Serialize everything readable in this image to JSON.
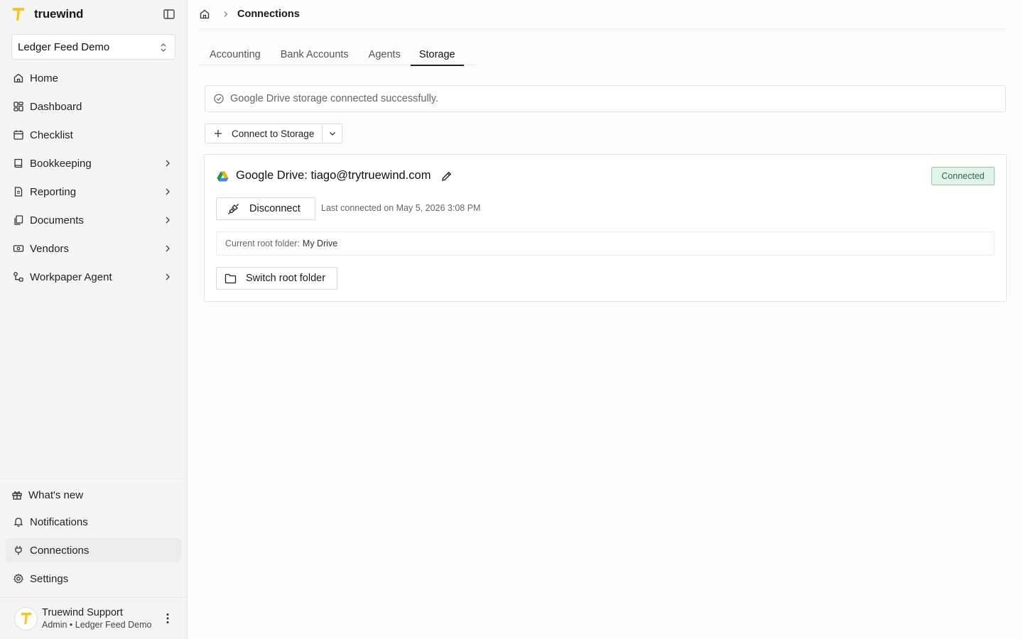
{
  "brand": {
    "name": "truewind",
    "accent": "#f5c518"
  },
  "org_select": {
    "value": "Ledger Feed Demo"
  },
  "sidebar": {
    "items": [
      {
        "label": "Home",
        "icon": "home-icon"
      },
      {
        "label": "Dashboard",
        "icon": "dashboard-icon"
      },
      {
        "label": "Checklist",
        "icon": "calendar-icon"
      },
      {
        "label": "Bookkeeping",
        "icon": "book-icon"
      },
      {
        "label": "Reporting",
        "icon": "report-icon"
      },
      {
        "label": "Documents",
        "icon": "documents-icon"
      },
      {
        "label": "Vendors",
        "icon": "vendors-icon"
      },
      {
        "label": "Workpaper Agent",
        "icon": "workflow-icon"
      }
    ],
    "bottom_items": [
      {
        "label": "What's new",
        "icon": "gift-icon"
      },
      {
        "label": "Notifications",
        "icon": "bell-icon"
      },
      {
        "label": "Connections",
        "icon": "plug-icon"
      },
      {
        "label": "Settings",
        "icon": "gear-icon"
      }
    ]
  },
  "user": {
    "name": "Truewind Support",
    "role": "Admin • Ledger Feed Demo"
  },
  "breadcrumb": {
    "current": "Connections"
  },
  "tabs": [
    {
      "label": "Accounting"
    },
    {
      "label": "Bank Accounts"
    },
    {
      "label": "Agents"
    },
    {
      "label": "Storage"
    }
  ],
  "alert": {
    "message": "Google Drive storage connected successfully."
  },
  "connect_button": {
    "label": "Connect to Storage"
  },
  "connection": {
    "title": "Google Drive: tiago@trytruewind.com",
    "status": "Connected",
    "disconnect_label": "Disconnect",
    "last_connected": "Last connected on May 5, 2026 3:08 PM",
    "root_folder_label": "Current root folder:",
    "root_folder_value": "My Drive",
    "switch_label": "Switch root folder"
  }
}
